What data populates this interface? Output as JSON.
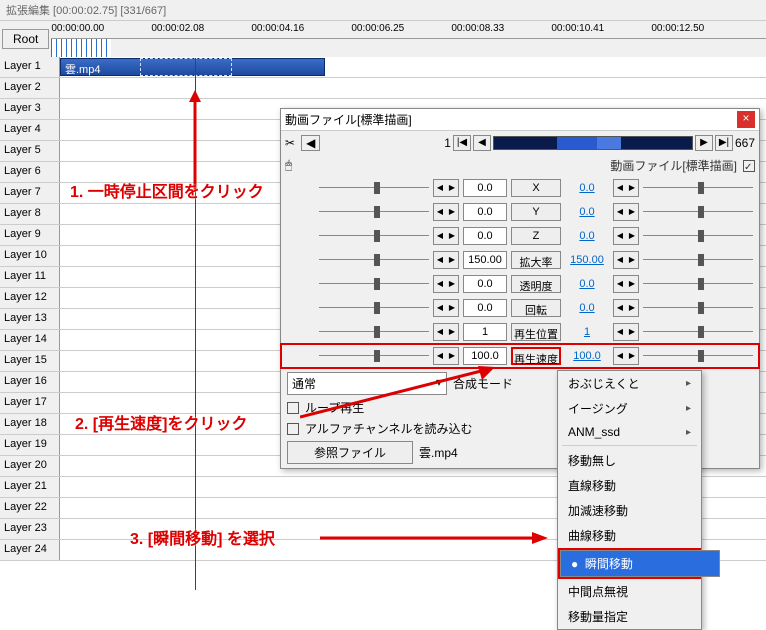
{
  "title": "拡張編集 [00:00:02.75] [331/667]",
  "root_label": "Root",
  "timecodes": [
    "00:00:00.00",
    "00:00:02.08",
    "00:00:04.16",
    "00:00:06.25",
    "00:00:08.33",
    "00:00:10.41",
    "00:00:12.50"
  ],
  "layers": [
    "Layer 1",
    "Layer 2",
    "Layer 3",
    "Layer 4",
    "Layer 5",
    "Layer 6",
    "Layer 7",
    "Layer 8",
    "Layer 9",
    "Layer 10",
    "Layer 11",
    "Layer 12",
    "Layer 13",
    "Layer 14",
    "Layer 15",
    "Layer 16",
    "Layer 17",
    "Layer 18",
    "Layer 19",
    "Layer 20",
    "Layer 21",
    "Layer 22",
    "Layer 23",
    "Layer 24"
  ],
  "clip_name": "雲.mp4",
  "props": {
    "title": "動画ファイル[標準描画]",
    "frame_current": "1",
    "frame_total": "667",
    "checkbox_label": "動画ファイル[標準描画]",
    "params": [
      {
        "name": "X",
        "left": "0.0",
        "right": "0.0"
      },
      {
        "name": "Y",
        "left": "0.0",
        "right": "0.0"
      },
      {
        "name": "Z",
        "left": "0.0",
        "right": "0.0"
      },
      {
        "name": "拡大率",
        "left": "150.00",
        "right": "150.00"
      },
      {
        "name": "透明度",
        "left": "0.0",
        "right": "0.0"
      },
      {
        "name": "回転",
        "left": "0.0",
        "right": "0.0"
      },
      {
        "name": "再生位置",
        "left": "1",
        "right": "1"
      },
      {
        "name": "再生速度",
        "left": "100.0",
        "right": "100.0"
      }
    ],
    "blend_mode": "通常",
    "blend_label": "合成モード",
    "loop_label": "ループ再生",
    "alpha_label": "アルファチャンネルを読み込む",
    "ref_label": "参照ファイル",
    "ref_file": "雲.mp4"
  },
  "menu": {
    "sub": [
      "おぶじえくと",
      "イージング",
      "ANM_ssd"
    ],
    "items": [
      "移動無し",
      "直線移動",
      "加減速移動",
      "曲線移動",
      "瞬間移動",
      "中間点無視",
      "移動量指定"
    ],
    "selected": "瞬間移動"
  },
  "annotations": {
    "a1": "1.  一時停止区間をクリック",
    "a2": "2. [再生速度]をクリック",
    "a3": "3. [瞬間移動] を選択"
  }
}
